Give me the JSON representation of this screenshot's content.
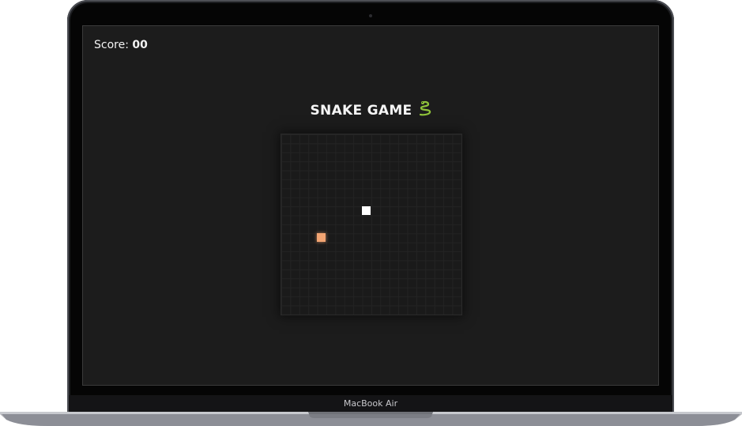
{
  "game": {
    "score_label": "Score:",
    "score_value": "00",
    "title": "SNAKE GAME",
    "title_icon": "snake-icon"
  },
  "device": {
    "model_label": "MacBook Air"
  },
  "colors": {
    "background": "#1c1c1c",
    "snake": "#ffffff",
    "food": "#f2a472",
    "snake_icon": "#8fc23a"
  }
}
